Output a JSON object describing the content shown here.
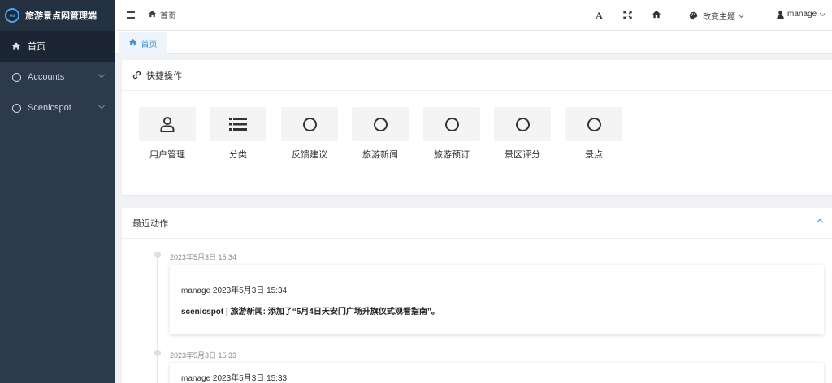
{
  "app": {
    "title": "旅游景点网管理端"
  },
  "sidebar": {
    "items": [
      {
        "label": "首页",
        "icon": "home-icon",
        "active": true
      },
      {
        "label": "Accounts",
        "icon": "circle-icon",
        "expandable": true
      },
      {
        "label": "Scenicspot",
        "icon": "circle-icon",
        "expandable": true
      }
    ]
  },
  "header": {
    "breadcrumb": "首页",
    "font_button": "A",
    "theme_label": "改变主题",
    "user_label": "manage"
  },
  "tabs": [
    {
      "label": "首页",
      "active": true
    }
  ],
  "quick_actions": {
    "title": "快捷操作",
    "items": [
      {
        "label": "用户管理",
        "icon": "user-icon"
      },
      {
        "label": "分类",
        "icon": "list-icon"
      },
      {
        "label": "反馈建议",
        "icon": "circle-icon"
      },
      {
        "label": "旅游新闻",
        "icon": "circle-icon"
      },
      {
        "label": "旅游预订",
        "icon": "circle-icon"
      },
      {
        "label": "景区评分",
        "icon": "circle-icon"
      },
      {
        "label": "景点",
        "icon": "circle-icon"
      }
    ]
  },
  "recent": {
    "title": "最近动作",
    "entries": [
      {
        "time": "2023年5月3日 15:34",
        "meta": "manage 2023年5月3日 15:34",
        "message": "scenicspot | 旅游新闻: 添加了“5月4日天安门广场升旗仪式观看指南”。"
      },
      {
        "time": "2023年5月3日 15:33",
        "meta": "manage 2023年5月3日 15:33",
        "message": ""
      }
    ]
  },
  "colors": {
    "sidebar_bg": "#2d3a4b",
    "accent": "#3f8fd2"
  }
}
